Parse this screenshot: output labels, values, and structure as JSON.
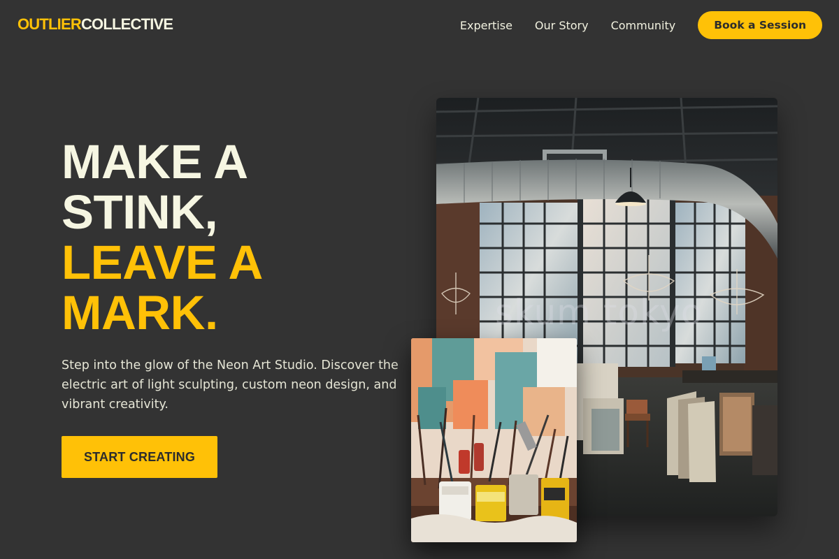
{
  "header": {
    "logo_part1": "OUTLIER",
    "logo_part2": "COLLECTIVE",
    "nav": [
      {
        "label": "Expertise"
      },
      {
        "label": "Our Story"
      },
      {
        "label": "Community"
      }
    ],
    "cta_label": "Book a Session"
  },
  "hero": {
    "title_lines": [
      "MAKE A",
      "STINK,",
      "LEAVE A",
      "MARK."
    ],
    "subtitle": "Step into the glow of the Neon Art Studio. Discover the electric art of light sculpting, custom neon design, and vibrant creativity.",
    "cta_label": "START CREATING"
  },
  "images": {
    "main_watermark": "skum tokyo"
  },
  "colors": {
    "background": "#333333",
    "accent": "#ffc107",
    "light_text": "#f6f6e2",
    "dark_text": "#2c2c2c"
  }
}
